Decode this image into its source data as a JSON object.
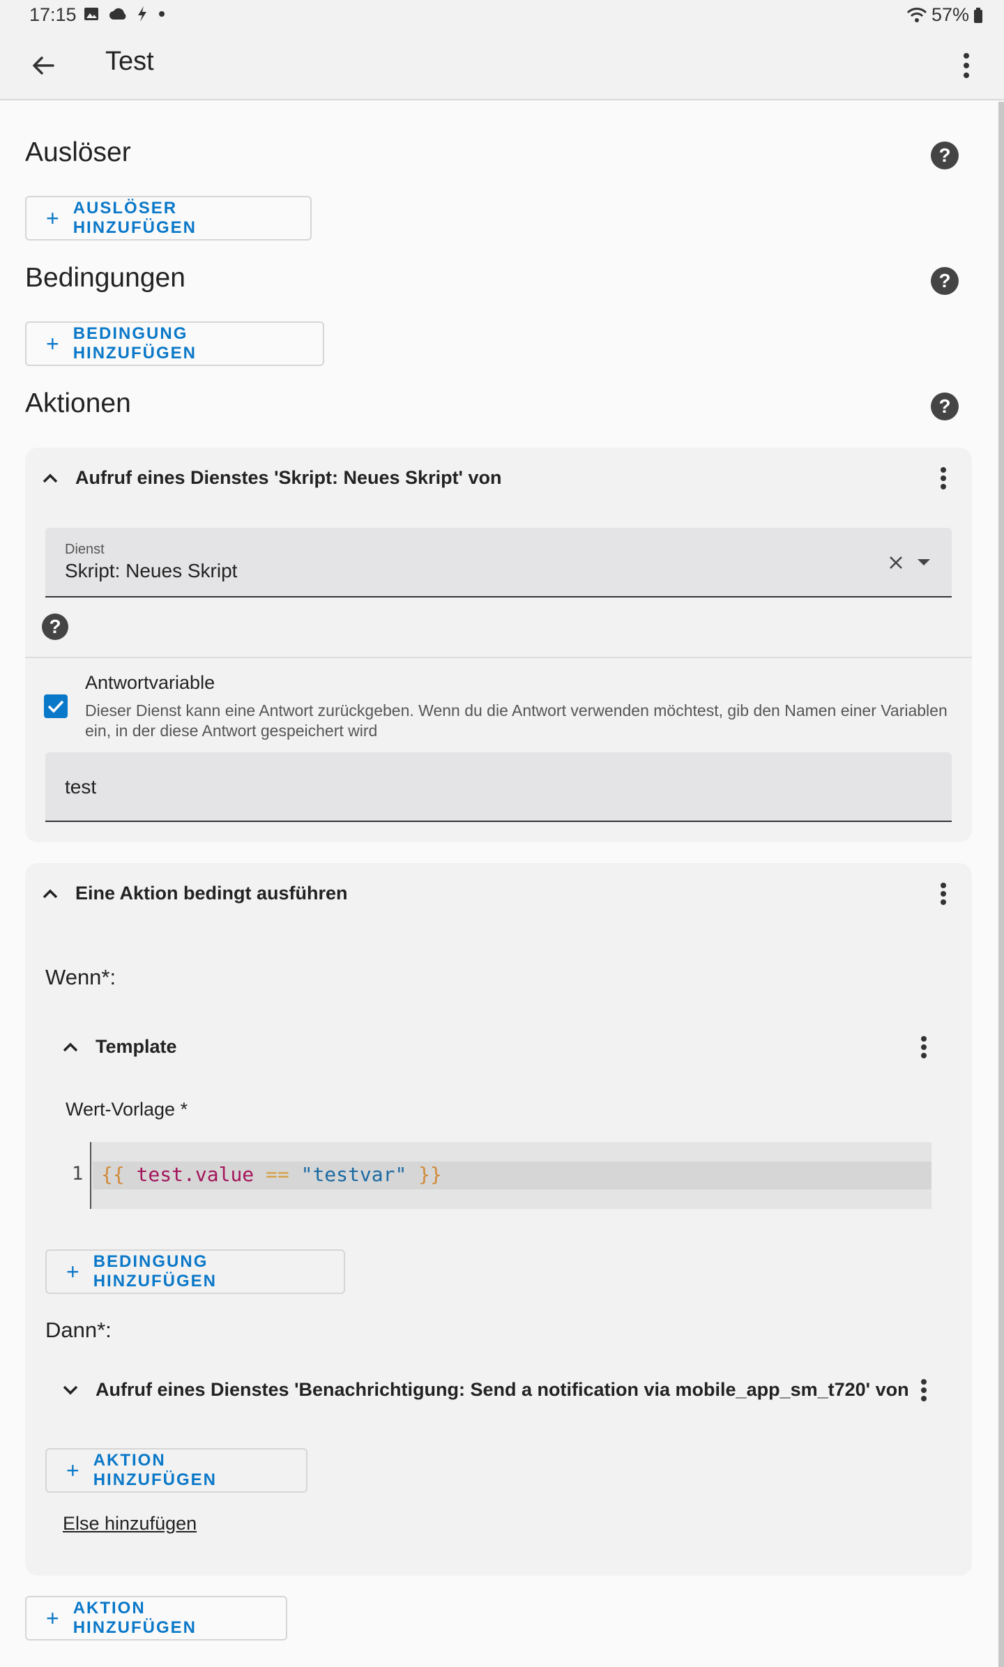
{
  "status_bar": {
    "time": "17:15",
    "battery": "57%"
  },
  "app_bar": {
    "title": "Test"
  },
  "sections": {
    "triggers": {
      "title": "Auslöser",
      "add_label": "AUSLÖSER HINZUFÜGEN"
    },
    "conditions": {
      "title": "Bedingungen",
      "add_label": "BEDINGUNG HINZUFÜGEN"
    },
    "actions": {
      "title": "Aktionen",
      "add_label": "AKTION HINZUFÜGEN"
    }
  },
  "action_service": {
    "title": "Aufruf eines Dienstes 'Skript: Neues Skript' von",
    "service_field": {
      "label": "Dienst",
      "value": "Skript: Neues Skript"
    },
    "response": {
      "checked": true,
      "title": "Antwortvariable",
      "description": "Dieser Dienst kann eine Antwort zurückgeben. Wenn du die Antwort verwenden möchtest, gib den Namen einer Variablen ein, in der diese Antwort gespeichert wird",
      "value": "test"
    }
  },
  "action_choose": {
    "title": "Eine Aktion bedingt ausführen",
    "if_label": "Wenn*:",
    "condition": {
      "title": "Template",
      "field_label": "Wert-Vorlage *",
      "line_number": "1",
      "code": {
        "open": "{{",
        "var": "test.value",
        "op": "==",
        "str": "\"testvar\"",
        "close": "}}"
      }
    },
    "add_condition_label": "BEDINGUNG HINZUFÜGEN",
    "then_label": "Dann*:",
    "then_action_title": "Aufruf eines Dienstes 'Benachrichtigung: Send a notification via mobile_app_sm_t720' von",
    "add_action_label": "AKTION HINZUFÜGEN",
    "else_link": "Else hinzufügen"
  },
  "colors": {
    "accent": "#0a78c8",
    "card_bg": "#f2f2f2",
    "field_bg": "#e4e4e6"
  }
}
